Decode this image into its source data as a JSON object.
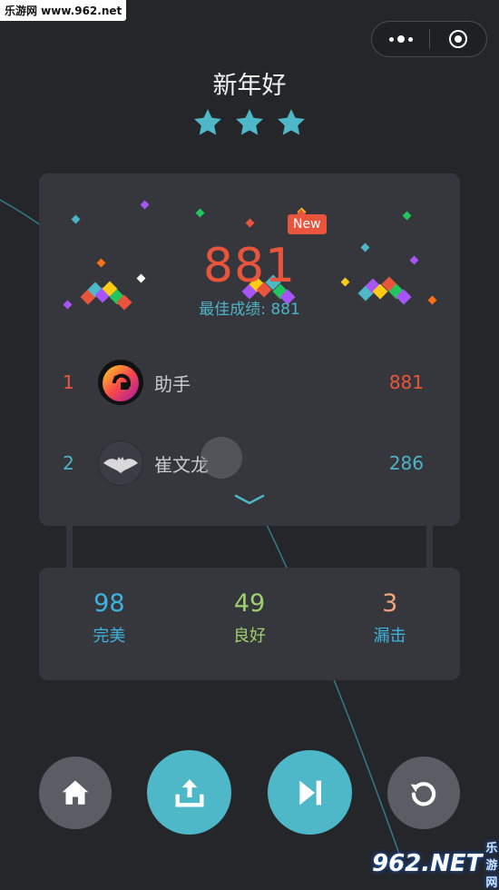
{
  "watermark_top": "乐游网 www.962.net",
  "title": "新年好",
  "stars": 3,
  "new_badge": "New",
  "score": "881",
  "best_score": "最佳成绩: 881",
  "leaderboard": [
    {
      "rank": "1",
      "name": "助手",
      "score": "881",
      "color": "#e8553c"
    },
    {
      "rank": "2",
      "name": "崔文龙",
      "score": "286",
      "color": "#4db3c8"
    }
  ],
  "stats": [
    {
      "value": "98",
      "label": "完美",
      "color": "#3fb3e0"
    },
    {
      "value": "49",
      "label": "良好",
      "color": "#9ed06e"
    },
    {
      "value": "3",
      "label": "漏击",
      "color": "#f2a47e"
    }
  ],
  "buttons": [
    "home-icon",
    "share-icon",
    "next-track-icon",
    "replay-icon"
  ],
  "watermark_br": {
    "main": "962.NET",
    "sub": "乐游网"
  },
  "colors": {
    "accent": "#4fb8c8",
    "score": "#e8553c",
    "card": "#36373c",
    "bg": "#25262a"
  }
}
